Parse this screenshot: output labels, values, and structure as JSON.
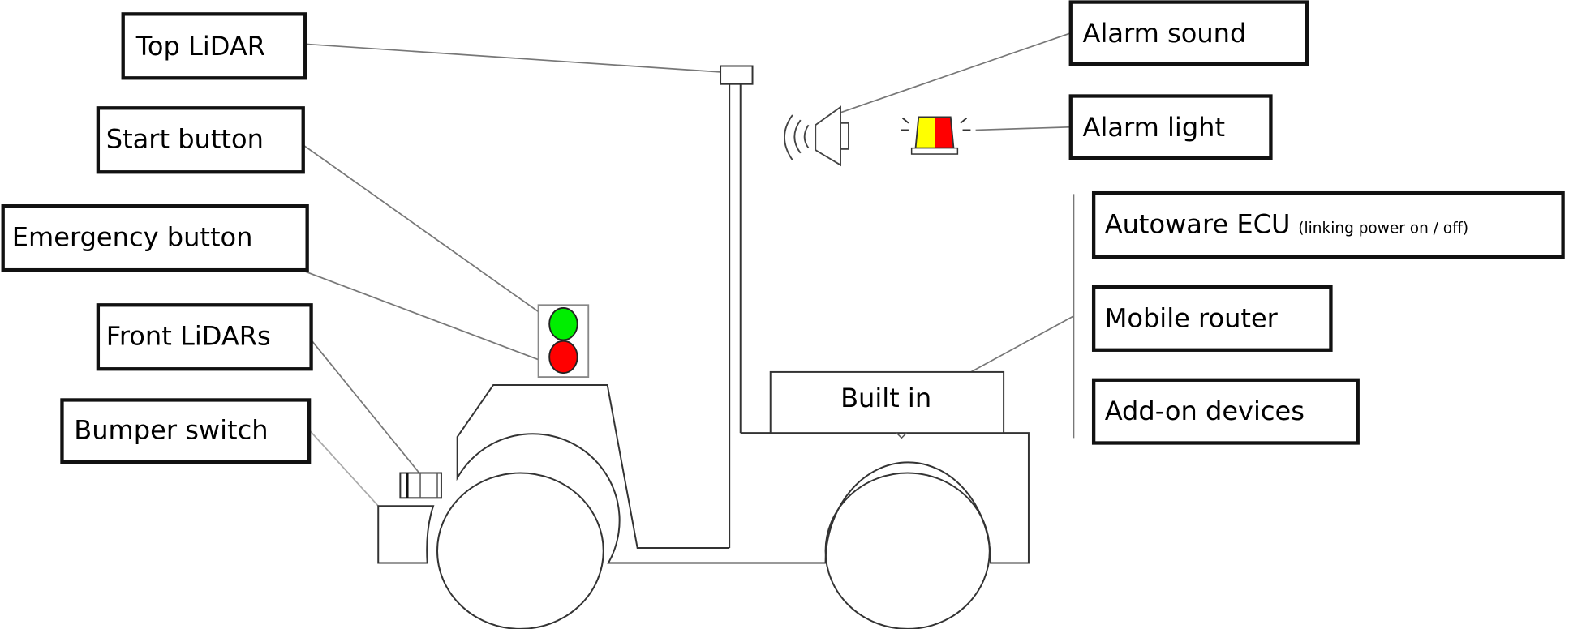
{
  "labels": {
    "top_lidar": "Top LiDAR",
    "start_button": "Start button",
    "emergency_button": "Emergency button",
    "front_lidars": "Front LiDARs",
    "bumper_switch": "Bumper switch",
    "alarm_sound": "Alarm sound",
    "alarm_light": "Alarm light",
    "autoware_ecu": "Autoware ECU",
    "autoware_ecu_note": "(linking power on / off)",
    "mobile_router": "Mobile router",
    "addon_devices": "Add-on devices",
    "built_in": "Built in"
  },
  "colors": {
    "start_button": "#00ee00",
    "emergency_button": "#ff0000",
    "beacon_left": "#ffff00",
    "beacon_right": "#ff0000"
  }
}
